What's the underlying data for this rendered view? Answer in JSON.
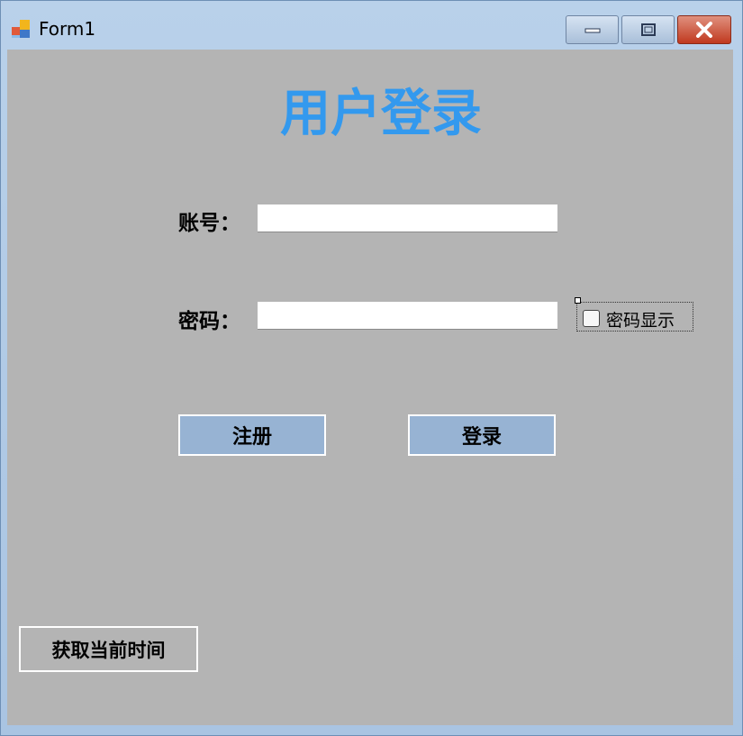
{
  "window": {
    "title": "Form1",
    "controls": [
      "minimize-icon",
      "maximize-icon",
      "close-icon"
    ]
  },
  "form": {
    "heading": "用户登录",
    "account_label": "账号：",
    "account_value": "",
    "password_label": "密码：",
    "password_value": "",
    "show_password_label": "密码显示",
    "show_password_checked": false
  },
  "buttons": {
    "register": "注册",
    "login": "登录",
    "get_time": "获取当前时间"
  },
  "colors": {
    "heading": "#3399ee",
    "client_bg": "#b4b4b4",
    "button_bg": "#97b3d3",
    "close_button": "#c0391f"
  }
}
